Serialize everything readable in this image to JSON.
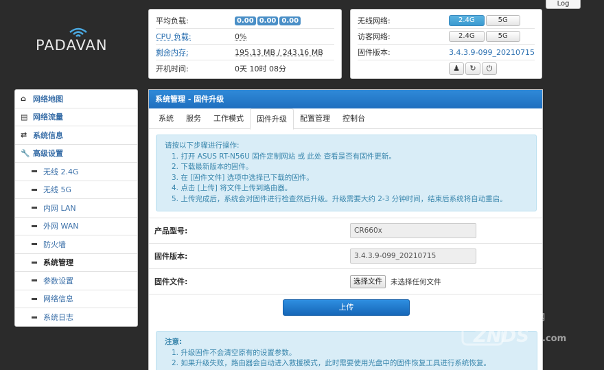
{
  "header": {
    "logout_label": "Log",
    "logo_text": "PADAVAN"
  },
  "status_left": {
    "rows": [
      {
        "label": "平均负载:",
        "badges": [
          "0.00",
          "0.00",
          "0.00"
        ]
      },
      {
        "label": "CPU 负载:",
        "value": "0%"
      },
      {
        "label": "剩余内存:",
        "value": "195.13 MB / 243.16 MB"
      },
      {
        "label": "开机时间:",
        "value": "0天 10时 08分"
      }
    ]
  },
  "status_right": {
    "wireless_label": "无线网络:",
    "guest_label": "访客网络:",
    "firmware_label": "固件版本:",
    "band_24": "2.4G",
    "band_5": "5G",
    "firmware_value": "3.4.3.9-099_20210715"
  },
  "menu": {
    "top": [
      {
        "label": "网络地图"
      },
      {
        "label": "网络流量"
      },
      {
        "label": "系统信息"
      },
      {
        "label": "高级设置"
      }
    ],
    "sub": [
      {
        "label": "无线 2.4G"
      },
      {
        "label": "无线 5G"
      },
      {
        "label": "内网 LAN"
      },
      {
        "label": "外网 WAN"
      },
      {
        "label": "防火墙"
      },
      {
        "label": "系统管理"
      },
      {
        "label": "参数设置"
      },
      {
        "label": "网络信息"
      },
      {
        "label": "系统日志"
      }
    ]
  },
  "main": {
    "title": "系统管理 - 固件升级",
    "tabs": [
      "系统",
      "服务",
      "工作模式",
      "固件升级",
      "配置管理",
      "控制台"
    ],
    "info_lines": [
      "请按以下步骤进行操作:",
      "1. 打开 ASUS RT-N56U 固件定制网站 或 此处 查看是否有固件更新。",
      "2. 下载最新版本的固件。",
      "3. 在 [固件文件] 选项中选择已下载的固件。",
      "4. 点击 [上传] 将文件上传到路由器。",
      "5. 上传完成后，系统会对固件进行检查然后升级。升级需要大约 2-3 分钟时间，结束后系统将自动重启。"
    ],
    "product_label": "产品型号:",
    "product_value": "CR660x",
    "fw_label": "固件版本:",
    "fw_value": "3.4.3.9-099_20210715",
    "file_label": "固件文件:",
    "file_button": "选择文件",
    "file_none": "未选择任何文件",
    "upload_label": "上传",
    "warn_title": "注意:",
    "warn_lines": [
      "1. 升级固件不会清空原有的设置参数。",
      "2. 如果升级失败，路由器会自动进入救援模式，此时需要使用光盘中的固件恢复工具进行系统恢复。"
    ]
  },
  "watermark": {
    "line1": "智能电视网",
    "line2": "ZNDS",
    "line3": ".com"
  }
}
